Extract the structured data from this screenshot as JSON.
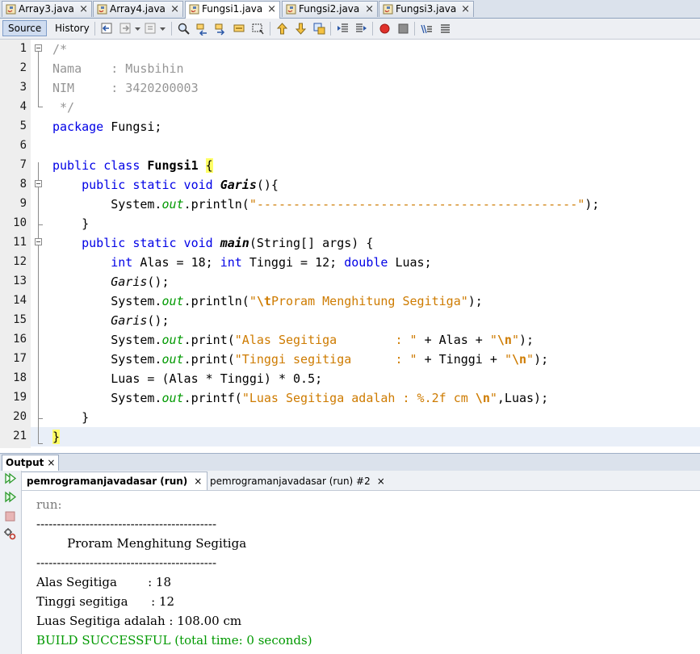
{
  "editor_tabs": [
    {
      "label": "Array3.java",
      "active": false
    },
    {
      "label": "Array4.java",
      "active": false
    },
    {
      "label": "Fungsi1.java",
      "active": true
    },
    {
      "label": "Fungsi2.java",
      "active": false
    },
    {
      "label": "Fungsi3.java",
      "active": false
    }
  ],
  "close_glyph": "×",
  "toolbar": {
    "source_label": "Source",
    "history_label": "History"
  },
  "gutter": {
    "line_numbers": [
      "1",
      "2",
      "3",
      "4",
      "5",
      "6",
      "7",
      "8",
      "9",
      "10",
      "11",
      "12",
      "13",
      "14",
      "15",
      "16",
      "17",
      "18",
      "19",
      "20",
      "21"
    ]
  },
  "code": {
    "l1": "/*",
    "l2": "Nama    : Musbihin",
    "l3": "NIM     : 3420200003",
    "l4": " */",
    "l5_kw": "package",
    "l5_rest": " Fungsi;",
    "l7_kw": "public class",
    "l7_name": "Fungsi1",
    "l7_brace": "{",
    "l8_kw": "public static void",
    "l8_name": "Garis",
    "l8_rest": "(){",
    "l9_a": "System.",
    "l9_out": "out",
    "l9_b": ".println(",
    "l9_str": "\"--------------------------------------------\"",
    "l9_c": ");",
    "l10": "}",
    "l11_kw": "public static void",
    "l11_name": "main",
    "l11_rest": "(String[] args) {",
    "l12_kw1": "int",
    "l12_a": " Alas = 18; ",
    "l12_kw2": "int",
    "l12_b": " Tinggi = 12; ",
    "l12_kw3": "double",
    "l12_c": " Luas;",
    "l13_call": "Garis",
    "l13_rest": "();",
    "l14_a": "System.",
    "l14_out": "out",
    "l14_b": ".println(",
    "l14_q": "\"",
    "l14_esc": "\\t",
    "l14_str": "Proram Menghitung Segitiga\"",
    "l14_c": ");",
    "l15_call": "Garis",
    "l15_rest": "();",
    "l16_a": "System.",
    "l16_out": "out",
    "l16_b": ".print(",
    "l16_str": "\"Alas Segitiga        : \"",
    "l16_c": " + Alas + ",
    "l16_q": "\"",
    "l16_esc": "\\n",
    "l16_q2": "\"",
    "l16_d": ");",
    "l17_a": "System.",
    "l17_out": "out",
    "l17_b": ".print(",
    "l17_str": "\"Tinggi segitiga      : \"",
    "l17_c": " + Tinggi + ",
    "l17_q": "\"",
    "l17_esc": "\\n",
    "l17_q2": "\"",
    "l17_d": ");",
    "l18": "Luas = (Alas * Tinggi) * 0.5;",
    "l19_a": "System.",
    "l19_out": "out",
    "l19_b": ".printf(",
    "l19_str": "\"Luas Segitiga adalah : %.2f cm ",
    "l19_esc": "\\n",
    "l19_q": "\"",
    "l19_c": ",Luas);",
    "l20": "}",
    "l21": "}"
  },
  "output": {
    "window_title": "Output",
    "run_tabs": [
      {
        "label": "pemrogramanjavadasar (run)",
        "active": true
      },
      {
        "label": "pemrogramanjavadasar (run) #2",
        "active": false
      }
    ],
    "lines": [
      {
        "text": "run:",
        "style": "gray"
      },
      {
        "text": "--------------------------------------------",
        "style": "normal"
      },
      {
        "text": "        Proram Menghitung Segitiga",
        "style": "normal"
      },
      {
        "text": "--------------------------------------------",
        "style": "normal"
      },
      {
        "text": "Alas Segitiga        : 18",
        "style": "normal"
      },
      {
        "text": "Tinggi segitiga      : 12",
        "style": "normal"
      },
      {
        "text": "Luas Segitiga adalah : 108.00 cm",
        "style": "normal"
      },
      {
        "text": "BUILD SUCCESSFUL (total time: 0 seconds)",
        "style": "green"
      }
    ]
  },
  "colors": {
    "keyword": "#0000e6",
    "string": "#ce7b00",
    "comment": "#969696",
    "field": "#009900",
    "build_success": "#009900",
    "brace_highlight": "#ffff66"
  },
  "icons": [
    "java-file-icon",
    "back-icon",
    "forward-icon",
    "find-icon",
    "find-previous-icon",
    "find-next-icon",
    "toggle-highlight-icon",
    "toggle-rectangular-selection-icon",
    "previous-bookmark-icon",
    "next-bookmark-icon",
    "toggle-bookmark-icon",
    "shift-left-icon",
    "shift-right-icon",
    "start-macro-icon",
    "stop-macro-icon",
    "comment-icon",
    "uncomment-icon",
    "rerun-icon",
    "rerun-different-icon",
    "stop-run-icon",
    "settings-icon"
  ]
}
